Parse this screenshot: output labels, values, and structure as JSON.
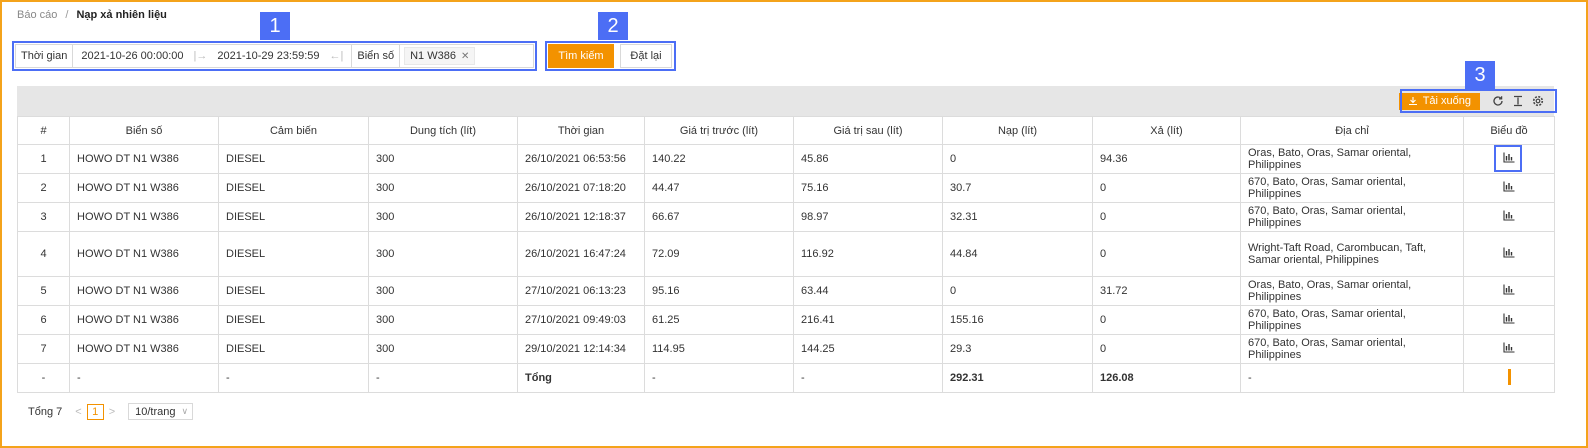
{
  "breadcrumb": {
    "root": "Báo cáo",
    "current": "Nạp xả nhiên liệu"
  },
  "callouts": [
    "1",
    "2",
    "3"
  ],
  "filter": {
    "time_label": "Thời gian",
    "start_date": "2021-10-26 00:00:00",
    "end_date": "2021-10-29 23:59:59",
    "plate_label": "Biển số",
    "plate_tag": "N1 W386"
  },
  "buttons": {
    "search": "Tìm kiếm",
    "reset": "Đặt lại",
    "download": "Tải xuống"
  },
  "table": {
    "columns": [
      "#",
      "Biển số",
      "Cảm biến",
      "Dung tích (lít)",
      "Thời gian",
      "Giá trị trước (lít)",
      "Giá trị sau (lít)",
      "Nạp (lít)",
      "Xả (lít)",
      "Địa chỉ",
      "Biểu đồ"
    ],
    "rows": [
      [
        "1",
        "HOWO DT N1 W386",
        "DIESEL",
        "300",
        "26/10/2021 06:53:56",
        "140.22",
        "45.86",
        "0",
        "94.36",
        "Oras, Bato, Oras, Samar oriental, Philippines"
      ],
      [
        "2",
        "HOWO DT N1 W386",
        "DIESEL",
        "300",
        "26/10/2021 07:18:20",
        "44.47",
        "75.16",
        "30.7",
        "0",
        "670, Bato, Oras, Samar oriental, Philippines"
      ],
      [
        "3",
        "HOWO DT N1 W386",
        "DIESEL",
        "300",
        "26/10/2021 12:18:37",
        "66.67",
        "98.97",
        "32.31",
        "0",
        "670, Bato, Oras, Samar oriental, Philippines"
      ],
      [
        "4",
        "HOWO DT N1 W386",
        "DIESEL",
        "300",
        "26/10/2021 16:47:24",
        "72.09",
        "116.92",
        "44.84",
        "0",
        "Wright-Taft Road, Carombucan, Taft, Samar oriental, Philippines"
      ],
      [
        "5",
        "HOWO DT N1 W386",
        "DIESEL",
        "300",
        "27/10/2021 06:13:23",
        "95.16",
        "63.44",
        "0",
        "31.72",
        "Oras, Bato, Oras, Samar oriental, Philippines"
      ],
      [
        "6",
        "HOWO DT N1 W386",
        "DIESEL",
        "300",
        "27/10/2021 09:49:03",
        "61.25",
        "216.41",
        "155.16",
        "0",
        "670, Bato, Oras, Samar oriental, Philippines"
      ],
      [
        "7",
        "HOWO DT N1 W386",
        "DIESEL",
        "300",
        "29/10/2021 12:14:34",
        "114.95",
        "144.25",
        "29.3",
        "0",
        "670, Bato, Oras, Samar oriental, Philippines"
      ]
    ],
    "total_row": [
      "-",
      "-",
      "-",
      "-",
      "Tổng",
      "-",
      "-",
      "292.31",
      "126.08",
      "-"
    ]
  },
  "pagination": {
    "total": "Tổng 7",
    "page": "1",
    "page_size": "10/trang"
  },
  "colors": {
    "accent": "#f39200",
    "callout": "#4c6ef5",
    "frame": "#f4a31b"
  }
}
